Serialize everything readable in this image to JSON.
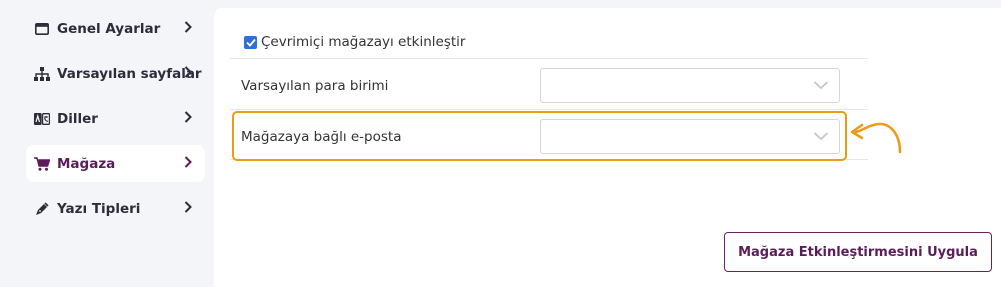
{
  "sidebar": {
    "items": [
      {
        "label": "Genel Ayarlar",
        "icon": "window-icon",
        "active": false
      },
      {
        "label": "Varsayılan sayfalar",
        "icon": "sitemap-icon",
        "active": false
      },
      {
        "label": "Diller",
        "icon": "language-icon",
        "active": false
      },
      {
        "label": "Mağaza",
        "icon": "cart-icon",
        "active": true
      },
      {
        "label": "Yazı Tipleri",
        "icon": "pen-icon",
        "active": false
      }
    ]
  },
  "form": {
    "enable_store": {
      "label": "Çevrimiçi mağazayı etkinleştir",
      "checked": true
    },
    "currency": {
      "label": "Varsayılan para birimi",
      "value": ""
    },
    "email": {
      "label": "Mağazaya bağlı e-posta",
      "value": ""
    }
  },
  "apply_button": {
    "label": "Mağaza Etkinleştirmesini Uygula"
  },
  "colors": {
    "accent": "#5b1d5a",
    "highlight": "#ec9b17",
    "checkbox": "#2f6fd6",
    "background": "#f4f5f8"
  }
}
